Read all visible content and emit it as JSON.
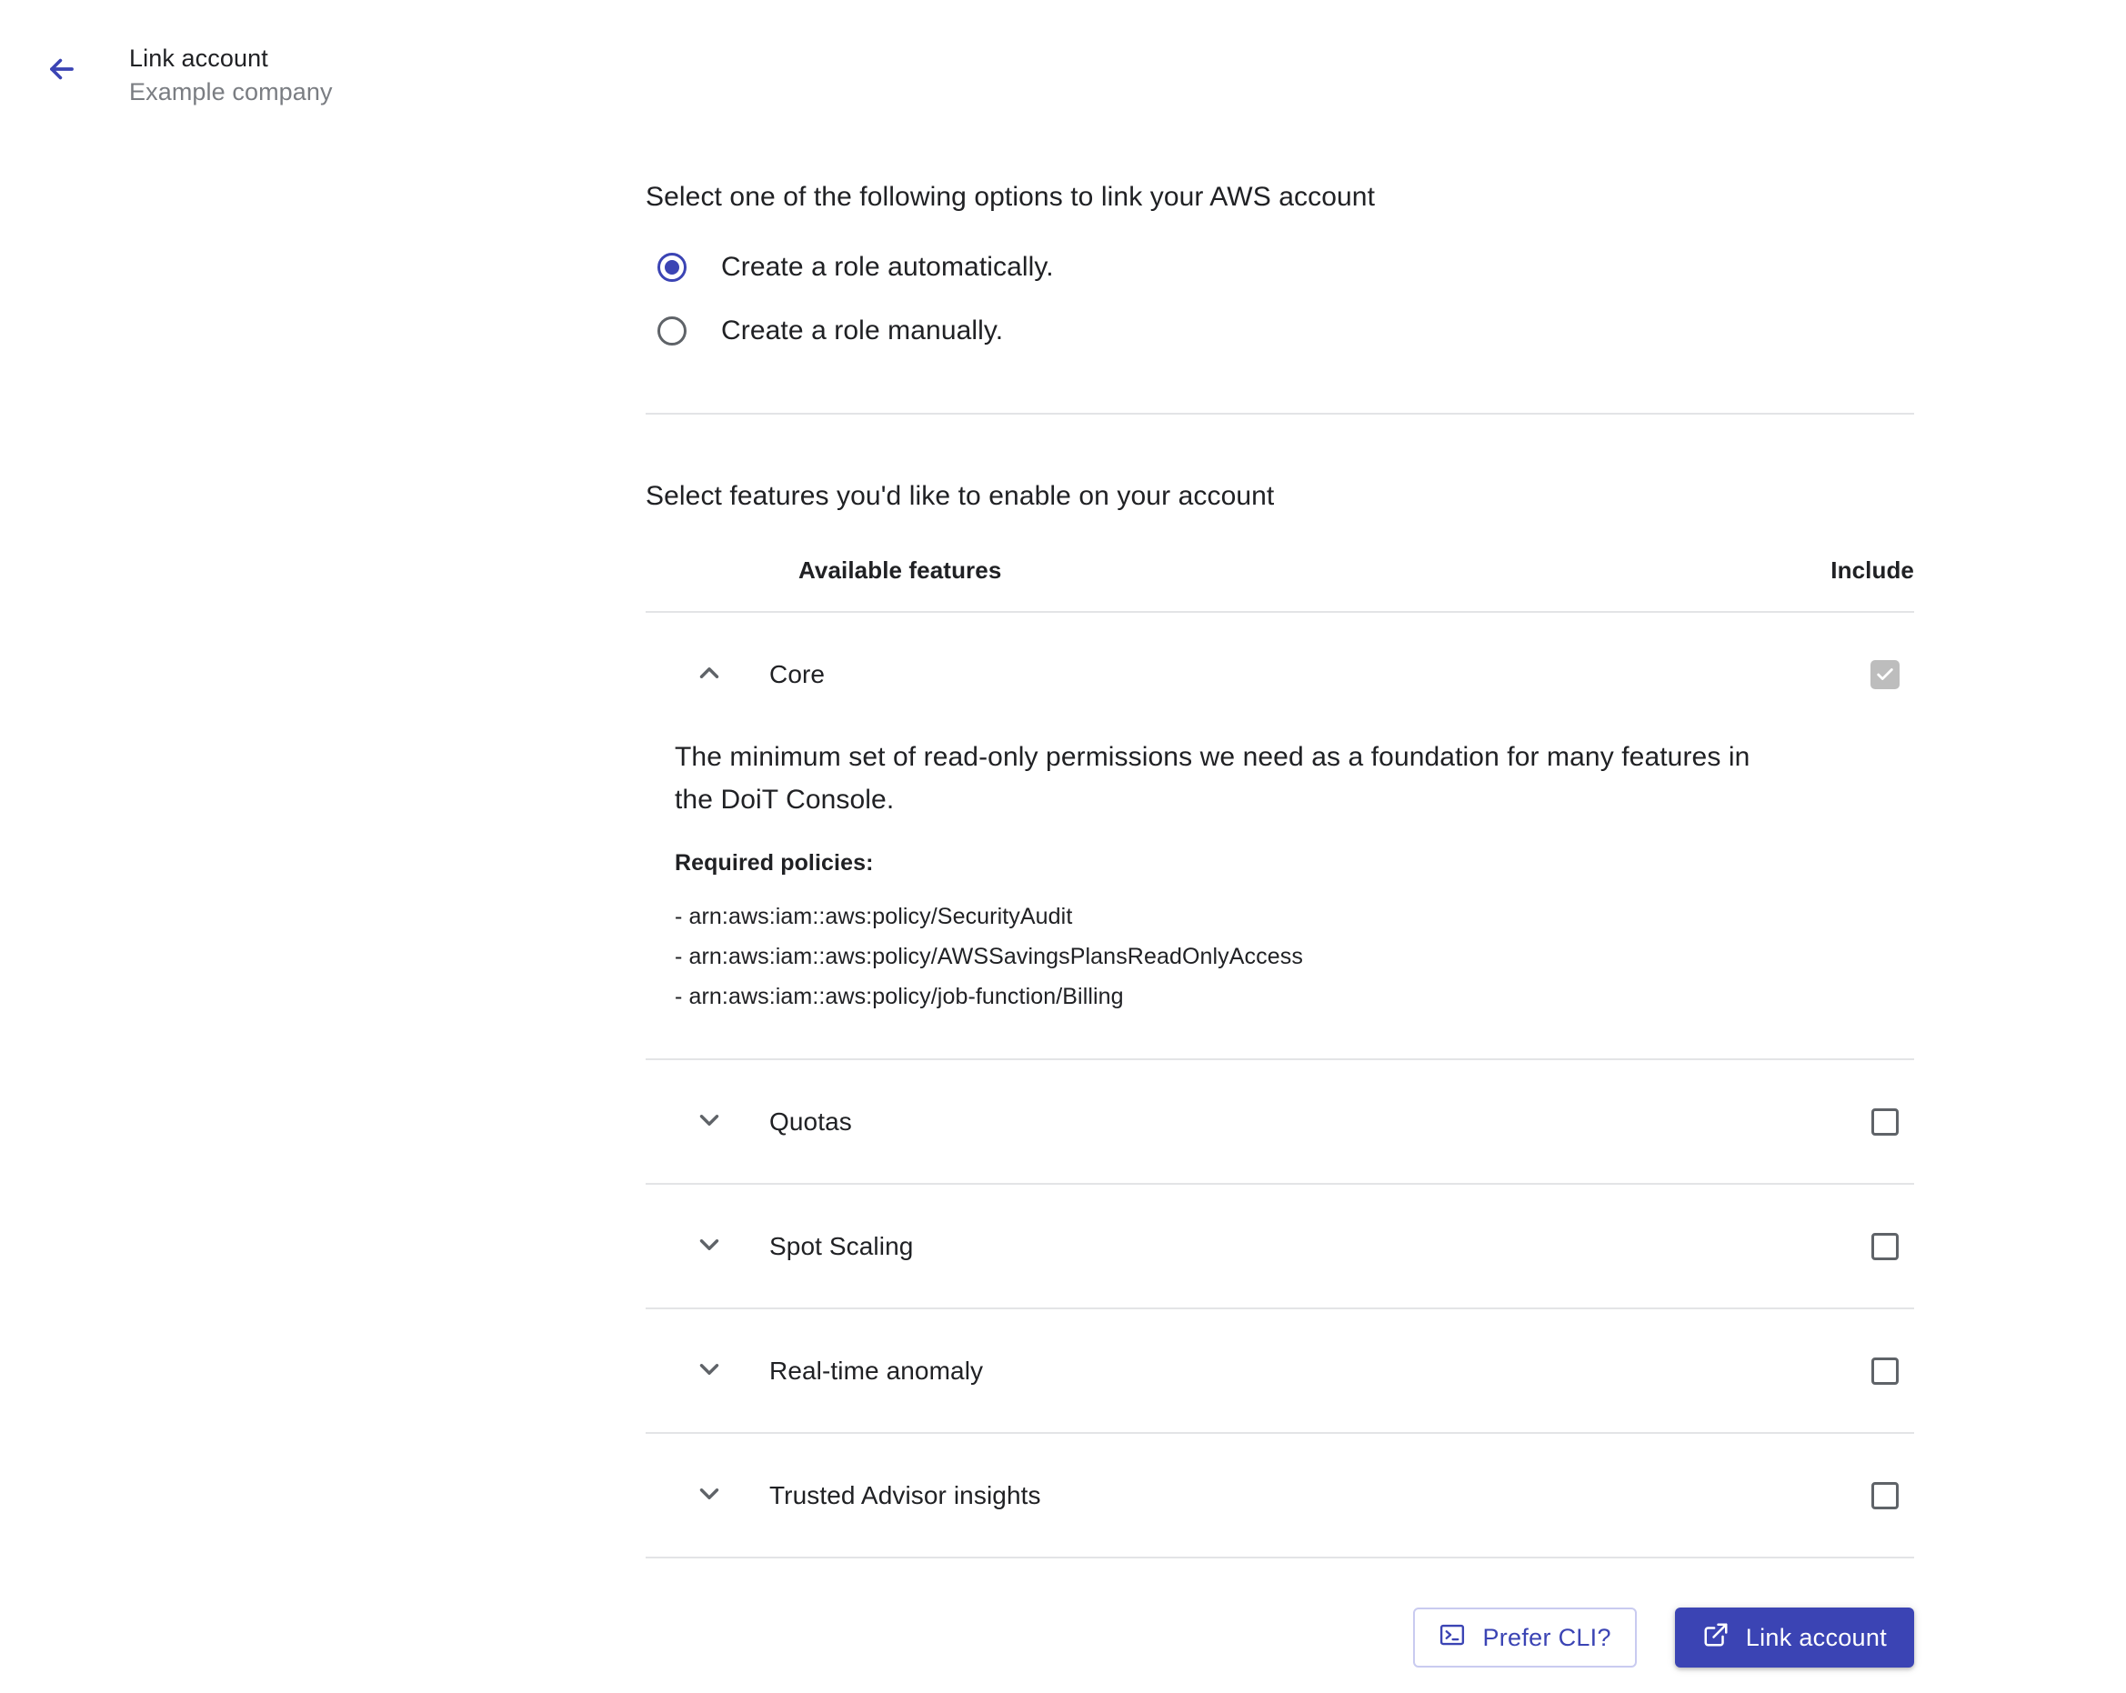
{
  "header": {
    "back_icon": "arrow-left-icon",
    "title": "Link account",
    "subtitle": "Example company"
  },
  "link_options": {
    "label": "Select one of the following options to link your AWS account",
    "options": [
      {
        "label": "Create a role automatically.",
        "selected": true
      },
      {
        "label": "Create a role manually.",
        "selected": false
      }
    ]
  },
  "features": {
    "label": "Select features you'd like to enable on your account",
    "columns": {
      "name": "Available features",
      "include": "Include"
    },
    "rows": [
      {
        "name": "Core",
        "expanded": true,
        "checked": true,
        "disabled": true,
        "chevron": "chevron-up-icon",
        "description": "The minimum set of read-only permissions we need as a foundation for many features in the DoiT Console.",
        "required_policies_title": "Required policies:",
        "policies": [
          "- arn:aws:iam::aws:policy/SecurityAudit",
          "- arn:aws:iam::aws:policy/AWSSavingsPlansReadOnlyAccess",
          "- arn:aws:iam::aws:policy/job-function/Billing"
        ]
      },
      {
        "name": "Quotas",
        "expanded": false,
        "checked": false,
        "chevron": "chevron-down-icon"
      },
      {
        "name": "Spot Scaling",
        "expanded": false,
        "checked": false,
        "chevron": "chevron-down-icon"
      },
      {
        "name": "Real-time anomaly",
        "expanded": false,
        "checked": false,
        "chevron": "chevron-down-icon"
      },
      {
        "name": "Trusted Advisor insights",
        "expanded": false,
        "checked": false,
        "chevron": "chevron-down-icon"
      }
    ]
  },
  "footer": {
    "cli_button": {
      "label": "Prefer CLI?",
      "icon": "terminal-icon"
    },
    "link_button": {
      "label": "Link account",
      "icon": "external-link-icon"
    }
  },
  "colors": {
    "accent": "#3b44b4",
    "text": "#202124",
    "muted": "#7a7d82",
    "divider": "#e3e4e6",
    "checkbox_disabled": "#bdbdbd"
  }
}
